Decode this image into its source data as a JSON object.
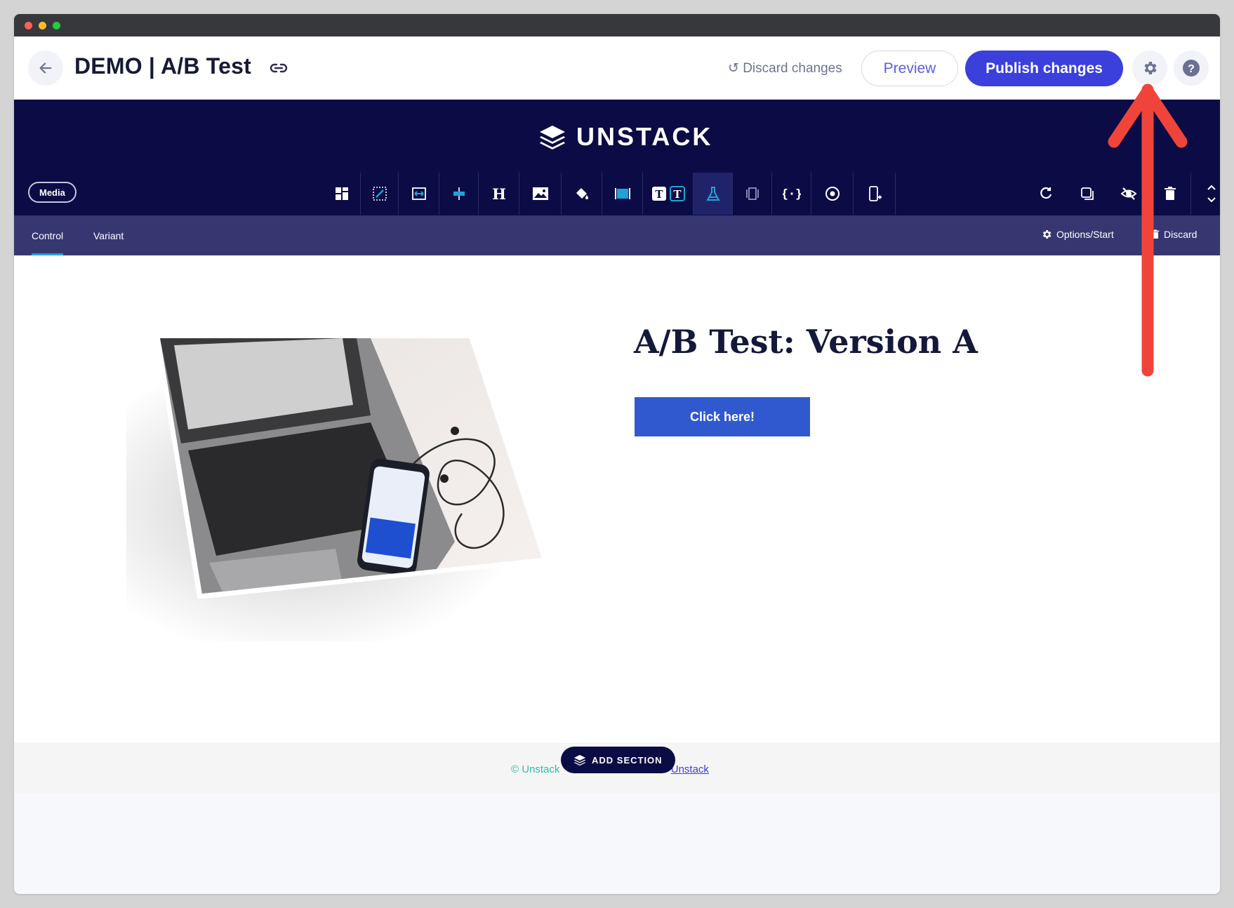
{
  "header": {
    "title": "DEMO | A/B Test",
    "discard_label": "Discard changes",
    "preview_label": "Preview",
    "publish_label": "Publish changes"
  },
  "brand": {
    "logo_text": "UNSTACK"
  },
  "section_toolbar": {
    "media_label": "Media",
    "tools": [
      "layout-icon",
      "crop-resize-icon",
      "width-icon",
      "align-icon",
      "heading-icon",
      "image-icon",
      "paint-bucket-icon",
      "background-icon",
      "text-style-icon",
      "ab-test-flask-icon",
      "columns-icon",
      "code-icon",
      "target-icon",
      "mobile-add-icon"
    ],
    "right_tools": [
      "refresh-icon",
      "duplicate-icon",
      "hide-icon",
      "delete-icon",
      "reorder-icon"
    ]
  },
  "tabs": {
    "control": "Control",
    "variant": "Variant",
    "options_start": "Options/Start",
    "discard": "Discard"
  },
  "content": {
    "headline": "A/B Test: Version A",
    "cta_label": "Click here!"
  },
  "footer": {
    "copyright_prefix": "© Unstack",
    "copyright_link": "Unstack",
    "add_section_label": "ADD SECTION"
  },
  "colors": {
    "brand_dark": "#0b0c45",
    "tab_bar": "#363770",
    "publish": "#3b3fdb",
    "cta": "#3159cf",
    "annotation_arrow": "#f0443a",
    "footer_text": "#2bc0a9"
  }
}
